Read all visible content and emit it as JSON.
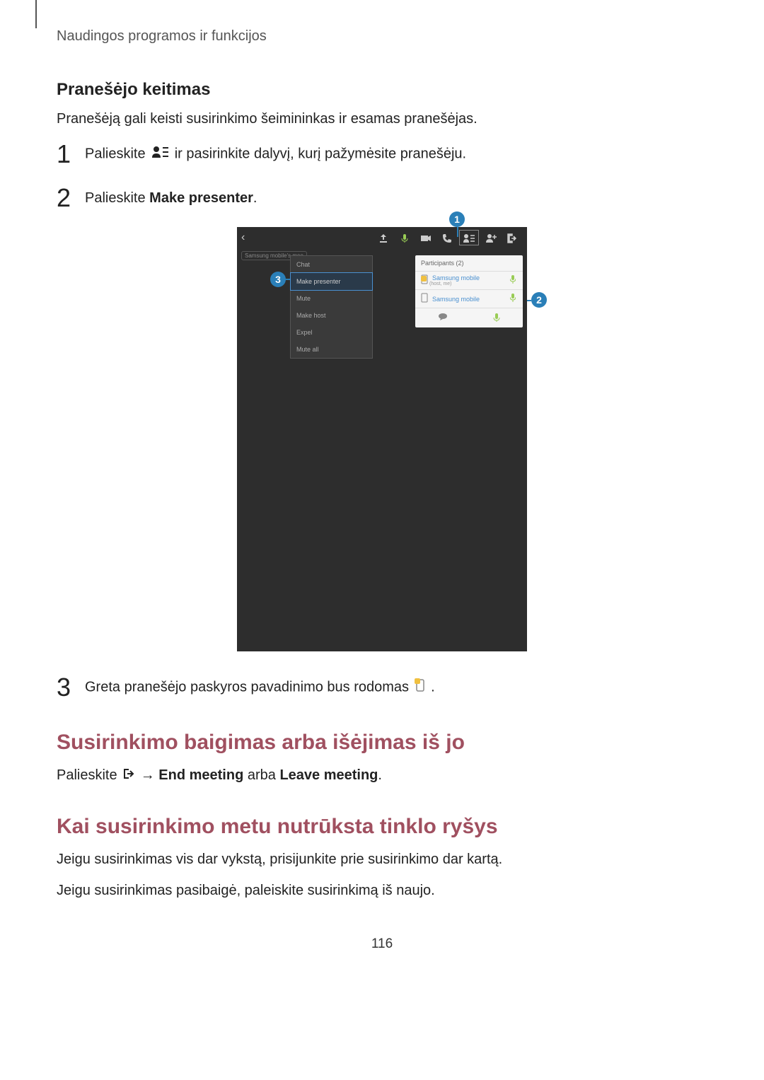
{
  "header": "Naudingos programos ir funkcijos",
  "sub_heading": "Pranešėjo keitimas",
  "intro": "Pranešėją gali keisti susirinkimo šeimininkas ir esamas pranešėjas.",
  "step1_pre": "Palieskite ",
  "step1_post": " ir pasirinkite dalyvį, kurį pažymėsite pranešėju.",
  "step2_pre": "Palieskite ",
  "step2_bold": "Make presenter",
  "step2_post": ".",
  "step3_pre": "Greta pranešėjo paskyros pavadinimo bus rodomas ",
  "step3_post": ".",
  "heading_end": "Susirinkimo baigimas arba išėjimas iš jo",
  "end_pre": "Palieskite ",
  "end_arrow": " → ",
  "end_b1": "End meeting",
  "end_mid": " arba ",
  "end_b2": "Leave meeting",
  "end_post": ".",
  "heading_net": "Kai susirinkimo metu nutrūksta tinklo ryšys",
  "net_p1": "Jeigu susirinkimas vis dar vykstą, prisijunkite prie susirinkimo dar kartą.",
  "net_p2": "Jeigu susirinkimas pasibaigė, paleiskite susirinkimą iš naujo.",
  "page_num": "116",
  "ss": {
    "tag": "Samsung mobile's mee",
    "dropdown": [
      "Chat",
      "Make presenter",
      "Mute",
      "Make host",
      "Expel",
      "Mute all"
    ],
    "panel_title": "Participants (2)",
    "p1_name": "Samsung mobile",
    "p1_sub": "(host, me)",
    "p2_name": "Samsung mobile"
  },
  "callouts": {
    "c1": "1",
    "c2": "2",
    "c3": "3"
  }
}
